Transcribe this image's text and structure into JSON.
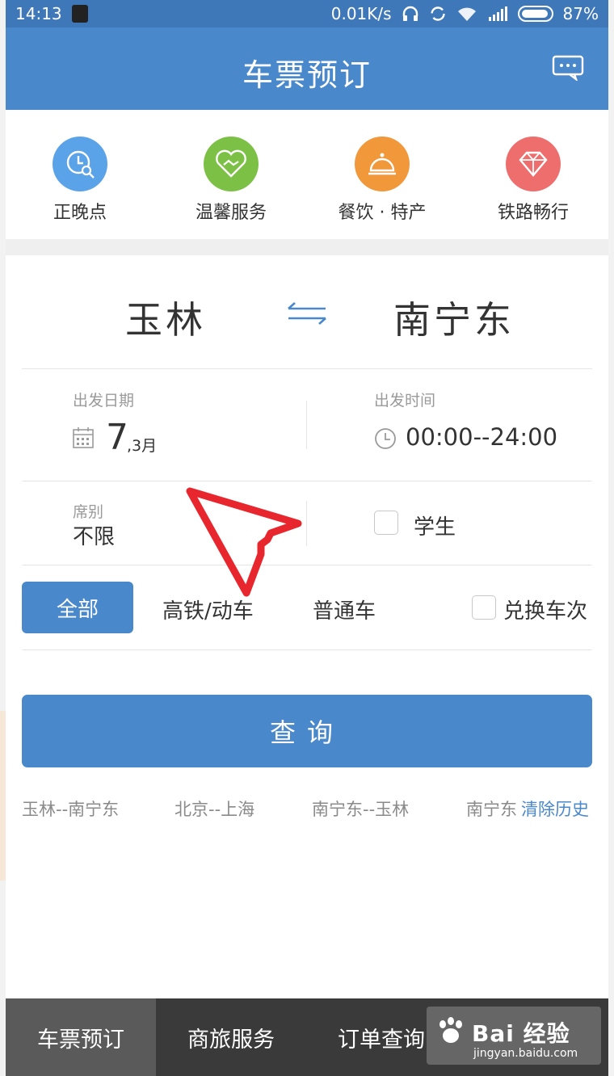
{
  "status_bar": {
    "time": "14:13",
    "speed": "0.01K/s",
    "battery": "87%"
  },
  "header": {
    "title": "车票预订"
  },
  "quick_icons": [
    {
      "label": "正晚点",
      "icon": "clock-search-icon",
      "color": "#5ba3e8"
    },
    {
      "label": "温馨服务",
      "icon": "heart-handshake-icon",
      "color": "#7cc146"
    },
    {
      "label": "餐饮 · 特产",
      "icon": "food-dome-icon",
      "color": "#f0983a"
    },
    {
      "label": "铁路畅行",
      "icon": "diamond-icon",
      "color": "#ee6e6e"
    }
  ],
  "route": {
    "from": "玉林",
    "to": "南宁东"
  },
  "departure_date": {
    "label": "出发日期",
    "day": "7",
    "month": ",3月"
  },
  "departure_time": {
    "label": "出发时间",
    "value": "00:00--24:00"
  },
  "seat": {
    "label": "席别",
    "value": "不限"
  },
  "student": {
    "label": "学生"
  },
  "train_types": {
    "all": "全部",
    "high_speed": "高铁/动车",
    "normal": "普通车"
  },
  "exchange": {
    "label": "兑换车次"
  },
  "search_button": "查询",
  "history": [
    "玉林--南宁东",
    "北京--上海",
    "南宁东--玉林",
    "南宁东"
  ],
  "clear_history": "清除历史",
  "bottom_nav": [
    "车票预订",
    "商旅服务",
    "订单查询"
  ],
  "watermark": {
    "brand": "Bai  经验",
    "url": "jingyan.baidu.com"
  },
  "colors": {
    "primary": "#4a88cc",
    "status": "#3f78b8",
    "bottom_bar": "#3a3a3a"
  }
}
